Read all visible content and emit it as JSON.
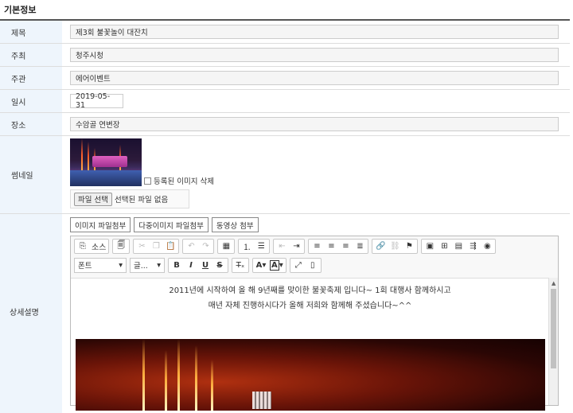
{
  "section_title": "기본정보",
  "fields": {
    "title": {
      "label": "제목",
      "value": "제3회 불꽃놀이 대잔치"
    },
    "host": {
      "label": "주최",
      "value": "청주시청"
    },
    "organizer": {
      "label": "주관",
      "value": "에어이벤트"
    },
    "date": {
      "label": "일시",
      "value": "2019-05-31"
    },
    "place": {
      "label": "장소",
      "value": "수암골 연변장"
    }
  },
  "thumbnail": {
    "label": "썸네일",
    "delete_label": "등록된 이미지 삭제",
    "file_button": "파일 선택",
    "file_status": "선택된 파일 없음"
  },
  "detail": {
    "label": "상세설명",
    "attach_tabs": [
      "이미지 파일첨부",
      "다중이미지 파일첨부",
      "동영상 첨부"
    ],
    "toolbar": {
      "source_label": "소스",
      "font_combo": "폰트",
      "size_combo": "글...",
      "bold": "B",
      "italic": "I",
      "underline": "U",
      "strike": "S",
      "text_color": "A",
      "bg_color": "A"
    },
    "content_lines": [
      "2011년에 시작하여 올 해 9년째를 맞이한 불꽃축제 입니다~ 1회 대행사 함께하시고",
      "매년 자체 진행하시다가 올해 저희와 함께해 주셨습니다~^^"
    ]
  }
}
